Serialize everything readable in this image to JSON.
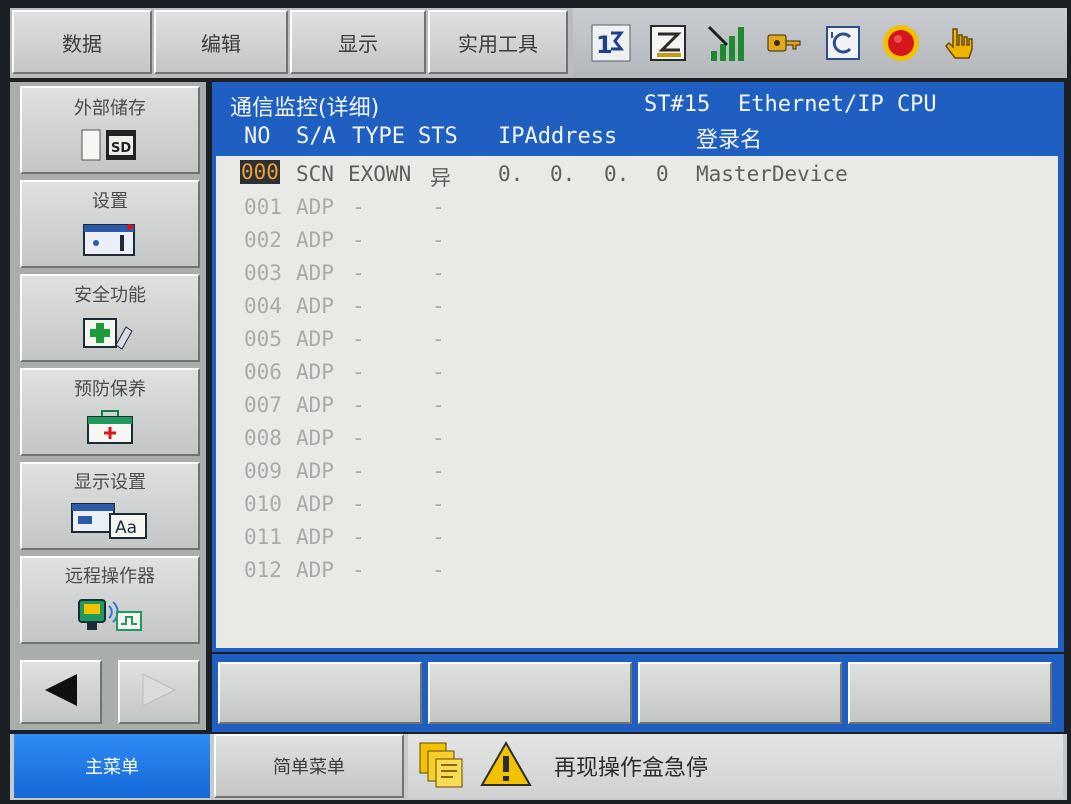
{
  "top_menu": {
    "tabs": [
      {
        "label": "数据"
      },
      {
        "label": "编辑"
      },
      {
        "label": "显示"
      },
      {
        "label": "实用工具"
      }
    ],
    "status_icons": [
      "sequence-1-2-icon",
      "edit-mode-icon",
      "signal-bars-icon",
      "robot-key-icon",
      "coordinate-c-icon",
      "emergency-stop-icon",
      "hand-pointer-icon"
    ]
  },
  "sidebar": {
    "items": [
      {
        "label": "外部储存",
        "icon": "sd-card-icon",
        "sd_text": "SD"
      },
      {
        "label": "设置",
        "icon": "settings-panel-icon"
      },
      {
        "label": "安全功能",
        "icon": "safety-function-icon"
      },
      {
        "label": "预防保养",
        "icon": "first-aid-kit-icon"
      },
      {
        "label": "显示设置",
        "icon": "display-settings-icon",
        "font_sample": "Aa"
      },
      {
        "label": "远程操作器",
        "icon": "remote-pendant-icon"
      }
    ],
    "nav": {
      "left": "page-left-arrow-icon",
      "right": "page-right-arrow-icon"
    }
  },
  "monitor": {
    "title": "通信监控(详细)",
    "station": "ST#15",
    "device": "Ethernet/IP CPU",
    "columns": {
      "no": "NO",
      "sa": "S/A",
      "type": "TYPE",
      "sts": "STS",
      "ip": "IPAddress",
      "name": "登录名"
    },
    "rows": [
      {
        "no": "000",
        "sa": "SCN",
        "type": "EXOWN",
        "sts": "异",
        "ip1": "0.",
        "ip2": "0.",
        "ip3": "0.",
        "ip4": "0",
        "name": "MasterDevice"
      },
      {
        "no": "001",
        "sa": "ADP",
        "type": "-",
        "sts": "-"
      },
      {
        "no": "002",
        "sa": "ADP",
        "type": "-",
        "sts": "-"
      },
      {
        "no": "003",
        "sa": "ADP",
        "type": "-",
        "sts": "-"
      },
      {
        "no": "004",
        "sa": "ADP",
        "type": "-",
        "sts": "-"
      },
      {
        "no": "005",
        "sa": "ADP",
        "type": "-",
        "sts": "-"
      },
      {
        "no": "006",
        "sa": "ADP",
        "type": "-",
        "sts": "-"
      },
      {
        "no": "007",
        "sa": "ADP",
        "type": "-",
        "sts": "-"
      },
      {
        "no": "008",
        "sa": "ADP",
        "type": "-",
        "sts": "-"
      },
      {
        "no": "009",
        "sa": "ADP",
        "type": "-",
        "sts": "-"
      },
      {
        "no": "010",
        "sa": "ADP",
        "type": "-",
        "sts": "-"
      },
      {
        "no": "011",
        "sa": "ADP",
        "type": "-",
        "sts": "-"
      },
      {
        "no": "012",
        "sa": "ADP",
        "type": "-",
        "sts": "-"
      }
    ]
  },
  "bottom": {
    "main_menu": "主菜单",
    "simple_menu": "简单菜单",
    "message": "再现操作盒急停"
  },
  "colors": {
    "header_blue": "#1f5fc2",
    "main_menu_blue": "#1f7ae6",
    "cursor_text": "#e6a23a",
    "estop_red": "#d8151b",
    "warning_yellow": "#f2c200"
  }
}
